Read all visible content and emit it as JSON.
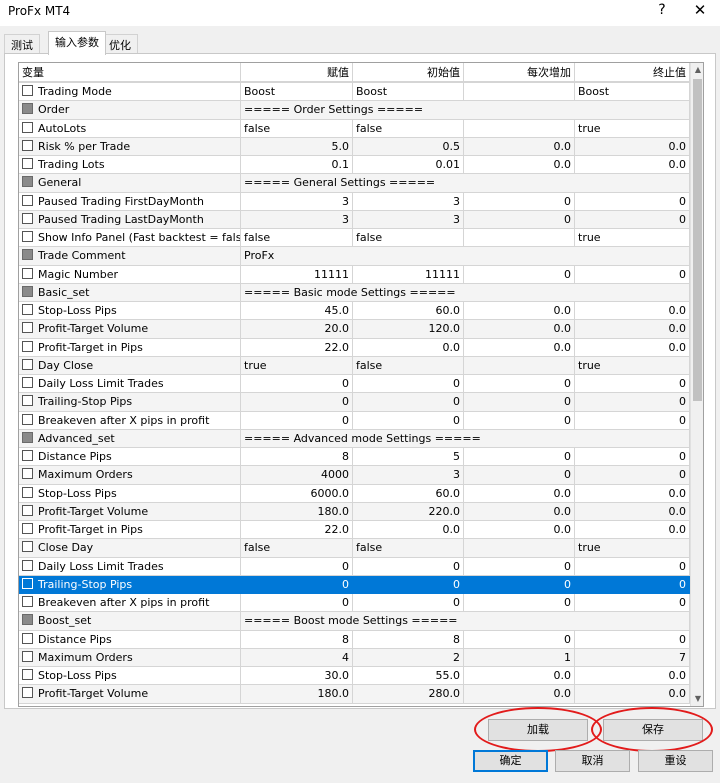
{
  "window": {
    "title": "ProFx MT4",
    "help_glyph": "?",
    "close_glyph": "✕"
  },
  "tabs": [
    {
      "label": "测试"
    },
    {
      "label": "输入参数",
      "active": true
    },
    {
      "label": "优化"
    }
  ],
  "columns": [
    "变量",
    "赋值",
    "初始值",
    "每次增加",
    "终止值"
  ],
  "rows": [
    {
      "name": "Trading Mode",
      "value": "Boost",
      "start": "Boost",
      "step": "",
      "stop": "Boost"
    },
    {
      "name": "Order",
      "group": true,
      "value": "===== Order Settings ====="
    },
    {
      "name": "AutoLots",
      "value": "false",
      "start": "false",
      "step": "",
      "stop": "true"
    },
    {
      "name": "Risk % per Trade",
      "value": "5.0",
      "start": "0.5",
      "step": "0.0",
      "stop": "0.0",
      "numeric": true
    },
    {
      "name": "Trading Lots",
      "value": "0.1",
      "start": "0.01",
      "step": "0.0",
      "stop": "0.0",
      "numeric": true
    },
    {
      "name": "General",
      "group": true,
      "value": "===== General Settings ====="
    },
    {
      "name": "Paused Trading FirstDayMonth",
      "value": "3",
      "start": "3",
      "step": "0",
      "stop": "0",
      "numeric": true
    },
    {
      "name": "Paused Trading LastDayMonth",
      "value": "3",
      "start": "3",
      "step": "0",
      "stop": "0",
      "numeric": true
    },
    {
      "name": "Show Info Panel (Fast backtest = false)",
      "value": "false",
      "start": "false",
      "step": "",
      "stop": "true"
    },
    {
      "name": "Trade Comment",
      "group": true,
      "value": "ProFx"
    },
    {
      "name": "Magic Number",
      "value": "11111",
      "start": "11111",
      "step": "0",
      "stop": "0",
      "numeric": true
    },
    {
      "name": "Basic_set",
      "group": true,
      "value": "===== Basic mode Settings ====="
    },
    {
      "name": "Stop-Loss Pips",
      "value": "45.0",
      "start": "60.0",
      "step": "0.0",
      "stop": "0.0",
      "numeric": true
    },
    {
      "name": "Profit-Target Volume",
      "value": "20.0",
      "start": "120.0",
      "step": "0.0",
      "stop": "0.0",
      "numeric": true
    },
    {
      "name": "Profit-Target in Pips",
      "value": "22.0",
      "start": "0.0",
      "step": "0.0",
      "stop": "0.0",
      "numeric": true
    },
    {
      "name": "Day Close",
      "value": "true",
      "start": "false",
      "step": "",
      "stop": "true"
    },
    {
      "name": "Daily Loss Limit Trades",
      "value": "0",
      "start": "0",
      "step": "0",
      "stop": "0",
      "numeric": true
    },
    {
      "name": "Trailing-Stop Pips",
      "value": "0",
      "start": "0",
      "step": "0",
      "stop": "0",
      "numeric": true
    },
    {
      "name": "Breakeven after X pips in profit",
      "value": "0",
      "start": "0",
      "step": "0",
      "stop": "0",
      "numeric": true
    },
    {
      "name": "Advanced_set",
      "group": true,
      "value": "===== Advanced mode Settings ====="
    },
    {
      "name": "Distance Pips",
      "value": "8",
      "start": "5",
      "step": "0",
      "stop": "0",
      "numeric": true
    },
    {
      "name": "Maximum Orders",
      "value": "4000",
      "start": "3",
      "step": "0",
      "stop": "0",
      "numeric": true
    },
    {
      "name": "Stop-Loss Pips",
      "value": "6000.0",
      "start": "60.0",
      "step": "0.0",
      "stop": "0.0",
      "numeric": true
    },
    {
      "name": "Profit-Target Volume",
      "value": "180.0",
      "start": "220.0",
      "step": "0.0",
      "stop": "0.0",
      "numeric": true
    },
    {
      "name": "Profit-Target in Pips",
      "value": "22.0",
      "start": "0.0",
      "step": "0.0",
      "stop": "0.0",
      "numeric": true
    },
    {
      "name": "Close Day",
      "value": "false",
      "start": "false",
      "step": "",
      "stop": "true"
    },
    {
      "name": "Daily Loss Limit Trades",
      "value": "0",
      "start": "0",
      "step": "0",
      "stop": "0",
      "numeric": true
    },
    {
      "name": "Trailing-Stop Pips",
      "value": "0",
      "start": "0",
      "step": "0",
      "stop": "0",
      "numeric": true,
      "selected": true
    },
    {
      "name": "Breakeven after X pips in profit",
      "value": "0",
      "start": "0",
      "step": "0",
      "stop": "0",
      "numeric": true
    },
    {
      "name": "Boost_set",
      "group": true,
      "value": "===== Boost mode Settings ====="
    },
    {
      "name": "Distance Pips",
      "value": "8",
      "start": "8",
      "step": "0",
      "stop": "0",
      "numeric": true
    },
    {
      "name": "Maximum Orders",
      "value": "4",
      "start": "2",
      "step": "1",
      "stop": "7",
      "numeric": true
    },
    {
      "name": "Stop-Loss Pips",
      "value": "30.0",
      "start": "55.0",
      "step": "0.0",
      "stop": "0.0",
      "numeric": true
    },
    {
      "name": "Profit-Target Volume",
      "value": "180.0",
      "start": "280.0",
      "step": "0.0",
      "stop": "0.0",
      "numeric": true
    }
  ],
  "buttons": {
    "load": "加载",
    "save": "保存",
    "ok": "确定",
    "cancel": "取消",
    "reset": "重设"
  },
  "colors": {
    "selection": "#0078d7",
    "annotation_circle": "#e21b1b"
  }
}
